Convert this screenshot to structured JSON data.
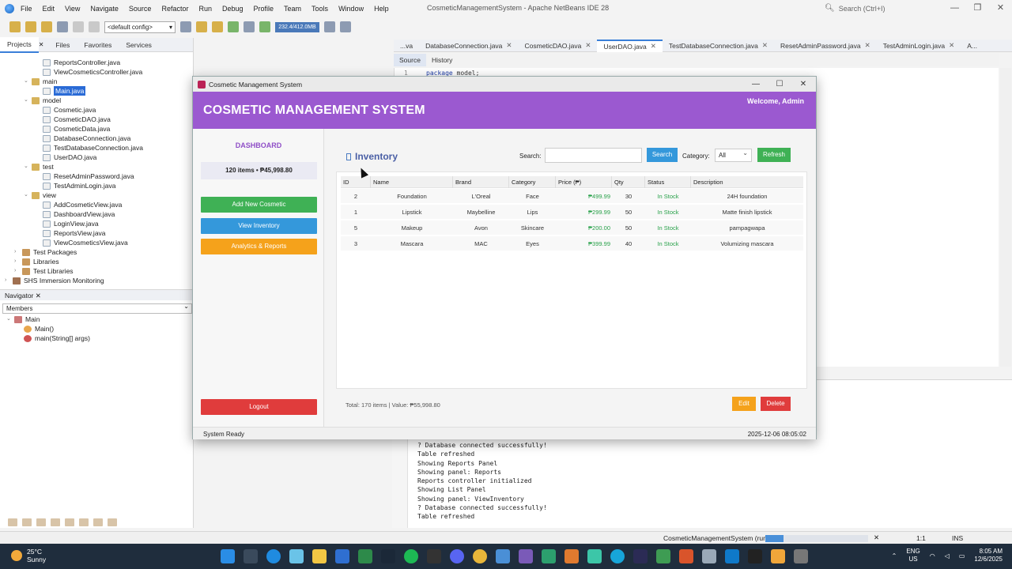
{
  "ide": {
    "title": "CosmeticManagementSystem - Apache NetBeans IDE 28",
    "menu": [
      "File",
      "Edit",
      "View",
      "Navigate",
      "Source",
      "Refactor",
      "Run",
      "Debug",
      "Profile",
      "Team",
      "Tools",
      "Window",
      "Help"
    ],
    "search_placeholder": "Search (Ctrl+I)",
    "config": "<default config>",
    "memory": "232.4/412.0MB",
    "panel_tabs": [
      "Projects",
      "Files",
      "Favorites",
      "Services"
    ],
    "tree": [
      {
        "label": "ReportsController.java",
        "type": "file"
      },
      {
        "label": "ViewCosmeticsController.java",
        "type": "file"
      },
      {
        "label": "main",
        "type": "pkg"
      },
      {
        "label": "Main.java",
        "type": "file",
        "selected": true
      },
      {
        "label": "model",
        "type": "pkg"
      },
      {
        "label": "Cosmetic.java",
        "type": "file"
      },
      {
        "label": "CosmeticDAO.java",
        "type": "file"
      },
      {
        "label": "CosmeticData.java",
        "type": "file"
      },
      {
        "label": "DatabaseConnection.java",
        "type": "file"
      },
      {
        "label": "TestDatabaseConnection.java",
        "type": "file"
      },
      {
        "label": "UserDAO.java",
        "type": "file"
      },
      {
        "label": "test",
        "type": "pkg"
      },
      {
        "label": "ResetAdminPassword.java",
        "type": "file"
      },
      {
        "label": "TestAdminLogin.java",
        "type": "file"
      },
      {
        "label": "view",
        "type": "pkg"
      },
      {
        "label": "AddCosmeticView.java",
        "type": "file"
      },
      {
        "label": "DashboardView.java",
        "type": "file"
      },
      {
        "label": "LoginView.java",
        "type": "file"
      },
      {
        "label": "ReportsView.java",
        "type": "file"
      },
      {
        "label": "ViewCosmeticsView.java",
        "type": "file"
      },
      {
        "label": "Test Packages",
        "type": "lib"
      },
      {
        "label": "Libraries",
        "type": "lib"
      },
      {
        "label": "Test Libraries",
        "type": "lib"
      },
      {
        "label": "SHS Immersion Monitoring",
        "type": "proj"
      }
    ],
    "navigator": {
      "title": "Navigator",
      "members": "Members",
      "items": [
        "Main",
        "Main()",
        "main(String[] args)"
      ]
    },
    "editor_tabs": [
      {
        "label": "...va"
      },
      {
        "label": "DatabaseConnection.java"
      },
      {
        "label": "CosmeticDAO.java"
      },
      {
        "label": "UserDAO.java",
        "active": true
      },
      {
        "label": "TestDatabaseConnection.java"
      },
      {
        "label": "ResetAdminPassword.java"
      },
      {
        "label": "TestAdminLogin.java"
      },
      {
        "label": "A..."
      }
    ],
    "source_tab": "Source",
    "history_tab": "History",
    "code_line_number": "1",
    "code_keyword": "package",
    "code_rest": " model;",
    "output_lines": [
      "? Database connected successfully!",
      "Table refreshed",
      "Showing Reports Panel",
      "Showing panel: Reports",
      "Reports controller initialized",
      "Showing List Panel",
      "Showing panel: ViewInventory",
      "? Database connected successfully!",
      "Table refreshed"
    ],
    "status": {
      "project": "CosmeticManagementSystem (run)",
      "progress": 0.18,
      "position": "1:1",
      "mode": "INS"
    }
  },
  "app": {
    "window_title": "Cosmetic Management System",
    "header_title": "COSMETIC MANAGEMENT SYSTEM",
    "welcome": "Welcome, Admin",
    "sidebar": {
      "dashboard": "DASHBOARD",
      "summary": "120 items • ₱45,998.80",
      "add": "Add New Cosmetic",
      "view": "View Inventory",
      "analytics": "Analytics & Reports",
      "logout": "Logout"
    },
    "inventory": {
      "title": "Inventory",
      "search_label": "Search:",
      "search_value": "",
      "search_button": "Search",
      "category_label": "Category:",
      "category_value": "All",
      "refresh": "Refresh",
      "columns": [
        "ID",
        "Name",
        "Brand",
        "Category",
        "Price (₱)",
        "Qty",
        "Status",
        "Description"
      ],
      "rows": [
        [
          "2",
          "Foundation",
          "L'Oreal",
          "Face",
          "₱499.99",
          "30",
          "In Stock",
          "24H foundation"
        ],
        [
          "1",
          "Lipstick",
          "Maybelline",
          "Lips",
          "₱299.99",
          "50",
          "In Stock",
          "Matte finish lipstick"
        ],
        [
          "5",
          "Makeup",
          "Avon",
          "Skincare",
          "₱200.00",
          "50",
          "In Stock",
          "pampagwapa"
        ],
        [
          "3",
          "Mascara",
          "MAC",
          "Eyes",
          "₱399.99",
          "40",
          "In Stock",
          "Volumizing mascara"
        ]
      ],
      "total": "Total: 170 items | Value: ₱55,998.80",
      "edit": "Edit",
      "delete": "Delete"
    },
    "status_left": "System Ready",
    "status_right": "2025-12-06 08:05:02"
  },
  "taskbar": {
    "temp": "25°C",
    "weather": "Sunny",
    "lang1": "ENG",
    "lang2": "US",
    "time": "8:05 AM",
    "date": "12/6/2025"
  },
  "colors": {
    "header": "#9b59d0",
    "add": "#3fb155",
    "view": "#3498db",
    "analytics": "#f5a21b",
    "logout": "#e03c3c"
  }
}
